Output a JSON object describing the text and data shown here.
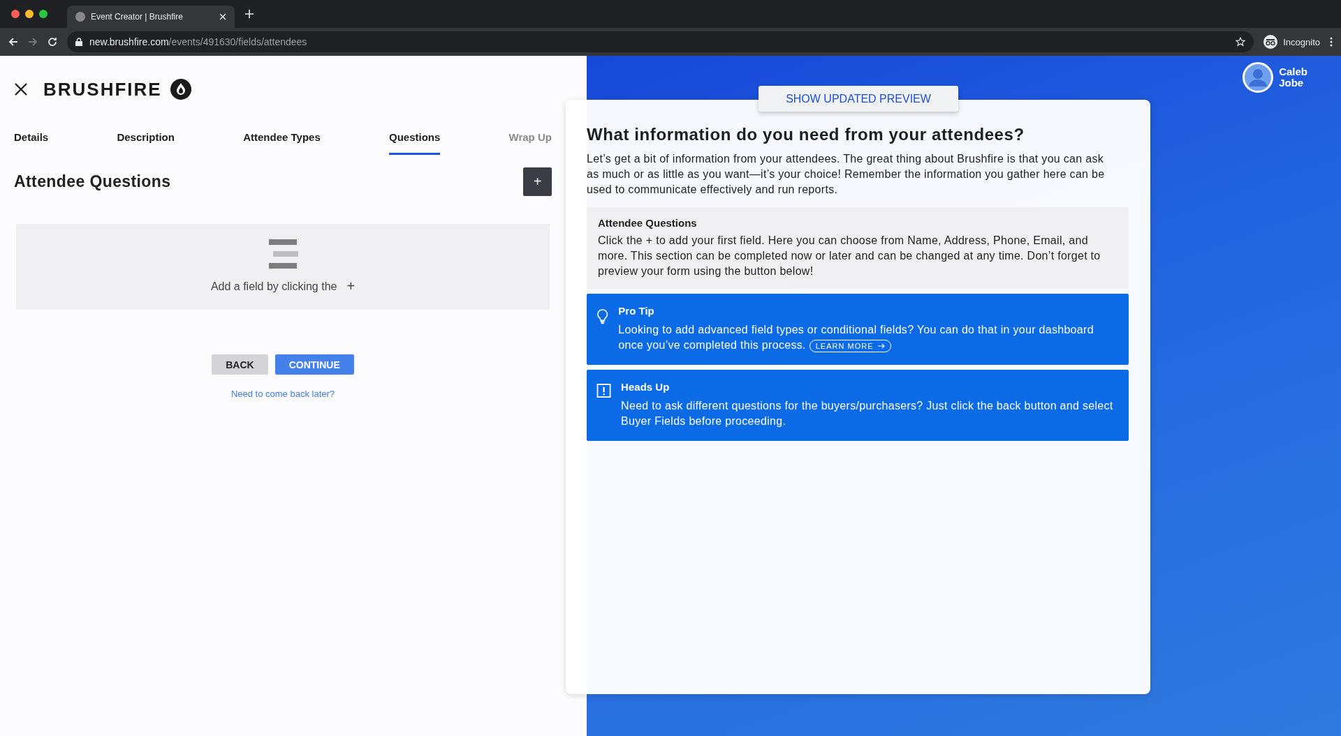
{
  "browser": {
    "tab_title": "Event Creator | Brushfire",
    "url_host": "new.brushfire.com",
    "url_path": "/events/491630/fields/attendees",
    "profile": "Incognito"
  },
  "header": {
    "brand": "BRUSHFIRE"
  },
  "tabs": [
    {
      "label": "Details",
      "selected": false,
      "disabled": false
    },
    {
      "label": "Description",
      "selected": false,
      "disabled": false
    },
    {
      "label": "Attendee Types",
      "selected": false,
      "disabled": false
    },
    {
      "label": "Questions",
      "selected": true,
      "disabled": false
    },
    {
      "label": "Wrap Up",
      "selected": false,
      "disabled": true
    }
  ],
  "section": {
    "title": "Attendee Questions",
    "add_button": "+",
    "empty_text": "Add a field by clicking the",
    "empty_plus": "+"
  },
  "actions": {
    "back": "BACK",
    "continue": "CONTINUE",
    "later_link": "Need to come back later?"
  },
  "user": {
    "first": "Caleb",
    "last": "Jobe"
  },
  "preview": {
    "button": "SHOW UPDATED PREVIEW",
    "heading": "What information do you need from your attendees?",
    "intro": "Let’s get a bit of information from your attendees. The great thing about Brushfire is that you can ask as much or as little as you want—it’s your choice! Remember the information you gather here can be used to communicate effectively and run reports.",
    "info": {
      "title": "Attendee Questions",
      "text": "Click the + to add your first field. Here you can choose from Name, Address, Phone, Email, and more. This section can be completed now or later and can be changed at any time. Don’t forget to preview your form using the button below!"
    },
    "notes": [
      {
        "kind": "tip",
        "title": "Pro Tip",
        "text": "Looking to add advanced field types or conditional fields? You can do that in your dashboard once you’ve completed this process.",
        "link": "LEARN MORE"
      },
      {
        "kind": "warning",
        "title": "Heads Up",
        "text": "Need to ask different questions for the buyers/purchasers? Just click the back button and select Buyer Fields before proceeding."
      }
    ]
  }
}
